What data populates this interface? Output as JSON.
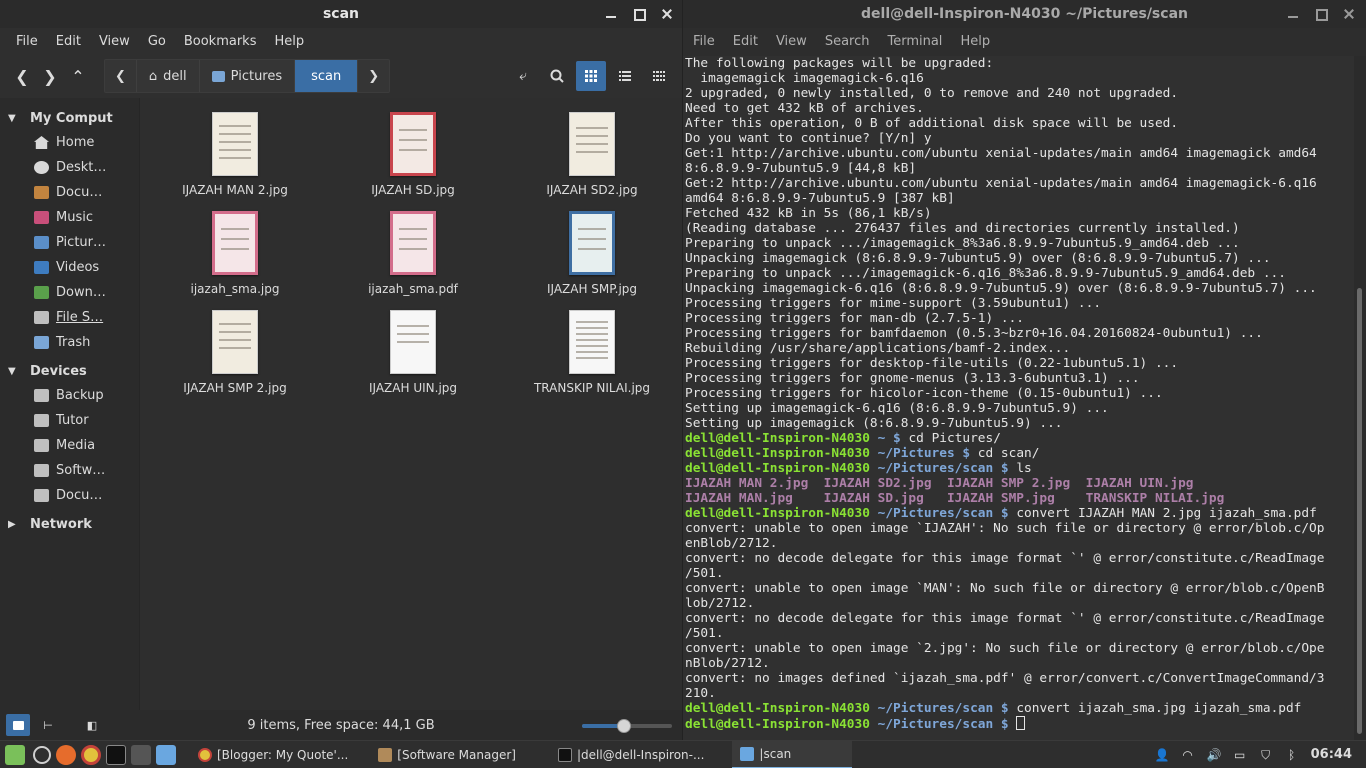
{
  "fm": {
    "title": "scan",
    "menu": [
      "File",
      "Edit",
      "View",
      "Go",
      "Bookmarks",
      "Help"
    ],
    "breadcrumbs": [
      "dell",
      "Pictures",
      "scan"
    ],
    "sidebar": {
      "sections": [
        {
          "title": "My Comput",
          "items": [
            {
              "label": "Home",
              "icon": "home"
            },
            {
              "label": "Deskt…",
              "icon": "desk"
            },
            {
              "label": "Docu…",
              "icon": "doc"
            },
            {
              "label": "Music",
              "icon": "music"
            },
            {
              "label": "Pictur…",
              "icon": "pic"
            },
            {
              "label": "Videos",
              "icon": "vid"
            },
            {
              "label": "Down…",
              "icon": "down"
            },
            {
              "label": "File S…",
              "icon": "drive"
            },
            {
              "label": "Trash",
              "icon": "trash"
            }
          ]
        },
        {
          "title": "Devices",
          "items": [
            {
              "label": "Backup",
              "icon": "drive"
            },
            {
              "label": "Tutor",
              "icon": "drive"
            },
            {
              "label": "Media",
              "icon": "drive"
            },
            {
              "label": "Softw…",
              "icon": "drive"
            },
            {
              "label": "Docu…",
              "icon": "drive"
            }
          ]
        },
        {
          "title": "Network",
          "items": []
        }
      ]
    },
    "files": [
      {
        "name": "IJAZAH MAN 2.jpg",
        "style": "scan"
      },
      {
        "name": "IJAZAH SD.jpg",
        "style": "red"
      },
      {
        "name": "IJAZAH SD2.jpg",
        "style": "scan"
      },
      {
        "name": "ijazah_sma.jpg",
        "style": "pink"
      },
      {
        "name": "ijazah_sma.pdf",
        "style": "pink"
      },
      {
        "name": "IJAZAH SMP.jpg",
        "style": "blue"
      },
      {
        "name": "IJAZAH SMP 2.jpg",
        "style": "scan"
      },
      {
        "name": "IJAZAH UIN.jpg",
        "style": "scan"
      },
      {
        "name": "TRANSKIP NILAI.jpg",
        "style": "scan"
      }
    ],
    "status": "9 items, Free space: 44,1 GB",
    "zoom_level": 0.47
  },
  "term": {
    "title": "dell@dell-Inspiron-N4030 ~/Pictures/scan",
    "menu": [
      "File",
      "Edit",
      "View",
      "Search",
      "Terminal",
      "Help"
    ],
    "lines": [
      {
        "t": "out",
        "text": "The following packages will be upgraded:"
      },
      {
        "t": "out",
        "text": "  imagemagick imagemagick-6.q16"
      },
      {
        "t": "out",
        "text": "2 upgraded, 0 newly installed, 0 to remove and 240 not upgraded."
      },
      {
        "t": "out",
        "text": "Need to get 432 kB of archives."
      },
      {
        "t": "out",
        "text": "After this operation, 0 B of additional disk space will be used."
      },
      {
        "t": "out",
        "text": "Do you want to continue? [Y/n] y"
      },
      {
        "t": "out",
        "text": "Get:1 http://archive.ubuntu.com/ubuntu xenial-updates/main amd64 imagemagick amd64"
      },
      {
        "t": "out",
        "text": "8:6.8.9.9-7ubuntu5.9 [44,8 kB]"
      },
      {
        "t": "out",
        "text": "Get:2 http://archive.ubuntu.com/ubuntu xenial-updates/main amd64 imagemagick-6.q16"
      },
      {
        "t": "out",
        "text": "amd64 8:6.8.9.9-7ubuntu5.9 [387 kB]"
      },
      {
        "t": "out",
        "text": "Fetched 432 kB in 5s (86,1 kB/s)"
      },
      {
        "t": "out",
        "text": "(Reading database ... 276437 files and directories currently installed.)"
      },
      {
        "t": "out",
        "text": "Preparing to unpack .../imagemagick_8%3a6.8.9.9-7ubuntu5.9_amd64.deb ..."
      },
      {
        "t": "out",
        "text": "Unpacking imagemagick (8:6.8.9.9-7ubuntu5.9) over (8:6.8.9.9-7ubuntu5.7) ..."
      },
      {
        "t": "out",
        "text": "Preparing to unpack .../imagemagick-6.q16_8%3a6.8.9.9-7ubuntu5.9_amd64.deb ..."
      },
      {
        "t": "out",
        "text": "Unpacking imagemagick-6.q16 (8:6.8.9.9-7ubuntu5.9) over (8:6.8.9.9-7ubuntu5.7) ..."
      },
      {
        "t": "out",
        "text": "Processing triggers for mime-support (3.59ubuntu1) ..."
      },
      {
        "t": "out",
        "text": "Processing triggers for man-db (2.7.5-1) ..."
      },
      {
        "t": "out",
        "text": "Processing triggers for bamfdaemon (0.5.3~bzr0+16.04.20160824-0ubuntu1) ..."
      },
      {
        "t": "out",
        "text": "Rebuilding /usr/share/applications/bamf-2.index..."
      },
      {
        "t": "out",
        "text": "Processing triggers for desktop-file-utils (0.22-1ubuntu5.1) ..."
      },
      {
        "t": "out",
        "text": "Processing triggers for gnome-menus (3.13.3-6ubuntu3.1) ..."
      },
      {
        "t": "out",
        "text": "Processing triggers for hicolor-icon-theme (0.15-0ubuntu1) ..."
      },
      {
        "t": "out",
        "text": "Setting up imagemagick-6.q16 (8:6.8.9.9-7ubuntu5.9) ..."
      },
      {
        "t": "out",
        "text": "Setting up imagemagick (8:6.8.9.9-7ubuntu5.9) ..."
      },
      {
        "t": "cmd",
        "user": "dell@dell-Inspiron-N4030",
        "path": "~",
        "cmd": "cd Pictures/"
      },
      {
        "t": "cmd",
        "user": "dell@dell-Inspiron-N4030",
        "path": "~/Pictures",
        "cmd": "cd scan/"
      },
      {
        "t": "cmd",
        "user": "dell@dell-Inspiron-N4030",
        "path": "~/Pictures/scan",
        "cmd": "ls"
      },
      {
        "t": "ls",
        "text": "IJAZAH MAN 2.jpg  IJAZAH SD2.jpg  IJAZAH SMP 2.jpg  IJAZAH UIN.jpg"
      },
      {
        "t": "ls",
        "text": "IJAZAH MAN.jpg    IJAZAH SD.jpg   IJAZAH SMP.jpg    TRANSKIP NILAI.jpg"
      },
      {
        "t": "cmd",
        "user": "dell@dell-Inspiron-N4030",
        "path": "~/Pictures/scan",
        "cmd": "convert IJAZAH MAN 2.jpg ijazah_sma.pdf"
      },
      {
        "t": "out",
        "text": "convert: unable to open image `IJAZAH': No such file or directory @ error/blob.c/Op"
      },
      {
        "t": "out",
        "text": "enBlob/2712."
      },
      {
        "t": "out",
        "text": "convert: no decode delegate for this image format `' @ error/constitute.c/ReadImage"
      },
      {
        "t": "out",
        "text": "/501."
      },
      {
        "t": "out",
        "text": "convert: unable to open image `MAN': No such file or directory @ error/blob.c/OpenB"
      },
      {
        "t": "out",
        "text": "lob/2712."
      },
      {
        "t": "out",
        "text": "convert: no decode delegate for this image format `' @ error/constitute.c/ReadImage"
      },
      {
        "t": "out",
        "text": "/501."
      },
      {
        "t": "out",
        "text": "convert: unable to open image `2.jpg': No such file or directory @ error/blob.c/Ope"
      },
      {
        "t": "out",
        "text": "nBlob/2712."
      },
      {
        "t": "out",
        "text": "convert: no images defined `ijazah_sma.pdf' @ error/convert.c/ConvertImageCommand/3"
      },
      {
        "t": "out",
        "text": "210."
      },
      {
        "t": "cmd",
        "user": "dell@dell-Inspiron-N4030",
        "path": "~/Pictures/scan",
        "cmd": "convert ijazah_sma.jpg ijazah_sma.pdf"
      },
      {
        "t": "cmd",
        "user": "dell@dell-Inspiron-N4030",
        "path": "~/Pictures/scan",
        "cmd": "",
        "cursor": true
      }
    ]
  },
  "taskbar": {
    "tasks": [
      {
        "label": "[Blogger: My Quote'...",
        "icon": "chrome"
      },
      {
        "label": "[Software Manager]",
        "icon": "sw"
      },
      {
        "label": "|dell@dell-Inspiron-...",
        "icon": "term"
      },
      {
        "label": "|scan",
        "icon": "folder",
        "active": true
      }
    ],
    "clock": "06:44"
  },
  "colors": {
    "accent": "#3a6ea5",
    "prompt": "#8ae234",
    "path": "#7fa7d9",
    "ls_file": "#ad7fa8"
  }
}
